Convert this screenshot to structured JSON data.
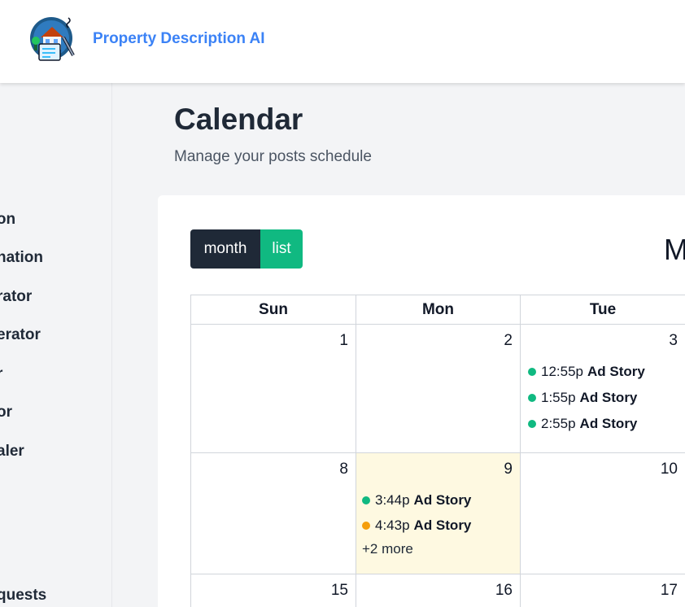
{
  "app": {
    "title": "Property Description AI",
    "accent_color": "#3b82f6",
    "logo_icon": "house-document-icon"
  },
  "sidebar": {
    "items": [
      {
        "label": "ription"
      },
      {
        "label": "nation"
      },
      {
        "label": "rator"
      },
      {
        "label": "erator"
      },
      {
        "label": "r"
      },
      {
        "label": "or"
      },
      {
        "label": "aler"
      },
      {
        "label": "quests"
      }
    ]
  },
  "page": {
    "title": "Calendar",
    "subtitle": "Manage your posts schedule"
  },
  "calendar": {
    "views": {
      "month": "month",
      "list": "list"
    },
    "title": "M",
    "weekdays": [
      "Sun",
      "Mon",
      "Tue"
    ],
    "weeks": [
      {
        "days": [
          {
            "num": "1",
            "events": []
          },
          {
            "num": "2",
            "events": []
          },
          {
            "num": "3",
            "events": [
              {
                "time": "12:55p",
                "title": "Ad Story",
                "color": "#10b981"
              },
              {
                "time": "1:55p",
                "title": "Ad Story",
                "color": "#10b981"
              },
              {
                "time": "2:55p",
                "title": "Ad Story",
                "color": "#10b981"
              }
            ]
          }
        ]
      },
      {
        "days": [
          {
            "num": "8",
            "events": []
          },
          {
            "num": "9",
            "today": true,
            "events": [
              {
                "time": "3:44p",
                "title": "Ad Story",
                "color": "#10b981"
              },
              {
                "time": "4:43p",
                "title": "Ad Story",
                "color": "#f59e0b"
              }
            ],
            "more": "+2 more"
          },
          {
            "num": "10",
            "events": []
          }
        ]
      },
      {
        "days": [
          {
            "num": "15",
            "events": []
          },
          {
            "num": "16",
            "events": []
          },
          {
            "num": "17",
            "events": []
          }
        ]
      }
    ]
  }
}
